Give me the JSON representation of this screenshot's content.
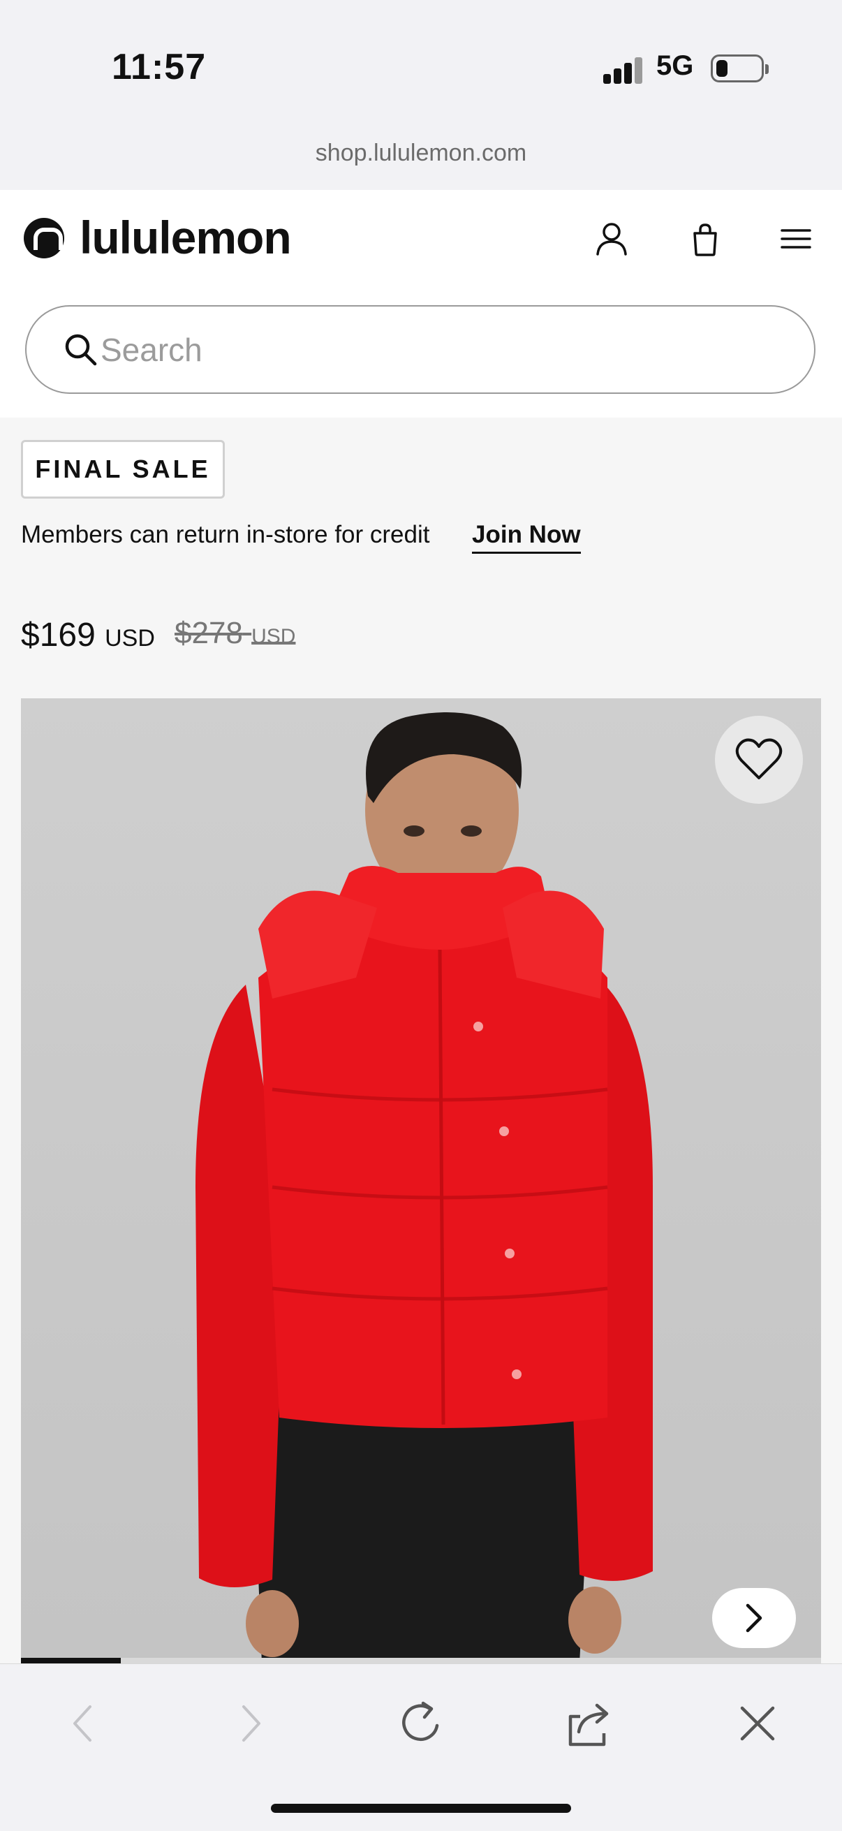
{
  "status": {
    "time": "11:57",
    "network": "5G"
  },
  "browser": {
    "url": "shop.lululemon.com"
  },
  "header": {
    "brand": "lululemon"
  },
  "search": {
    "placeholder": "Search"
  },
  "product": {
    "badge": "FINAL SALE",
    "members_text": "Members can return in-store for credit",
    "join_label": "Join Now",
    "price": "$169",
    "price_currency": "USD",
    "original_price": "$278",
    "original_currency": "USD",
    "gallery_progress": 0.125
  },
  "colors": {
    "jacket": "#e8141c",
    "pants": "#1b1b1b",
    "background": "#c9c9c9"
  },
  "icons": [
    "account-icon",
    "bag-icon",
    "menu-icon",
    "search-icon",
    "heart-icon",
    "chevron-right-icon",
    "back-icon",
    "forward-icon",
    "reload-icon",
    "share-icon",
    "close-icon"
  ]
}
